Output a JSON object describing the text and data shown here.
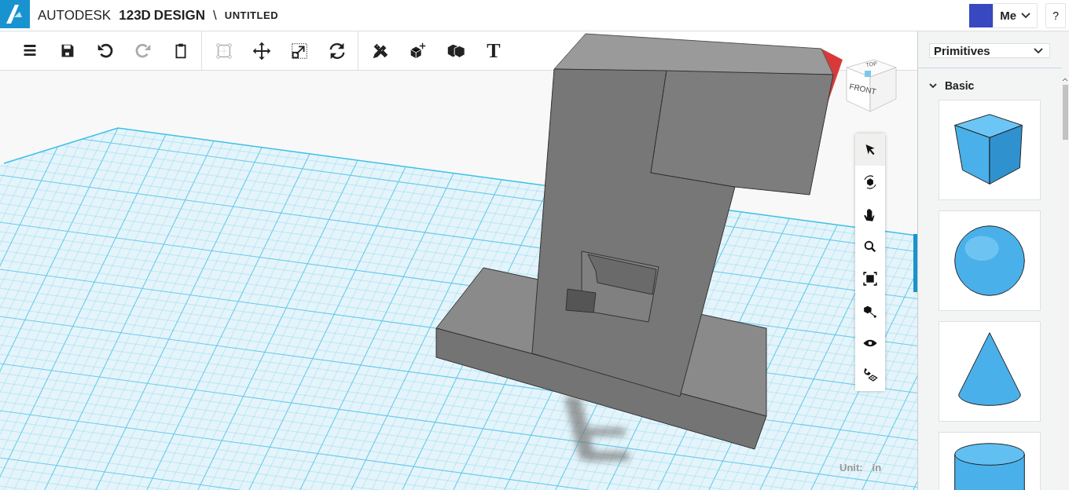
{
  "header": {
    "brand": "AUTODESK",
    "product": "123D",
    "product_tail": "DESIGN",
    "separator": "\\",
    "document": "UNTITLED",
    "user": "Me",
    "help": "?"
  },
  "toolbar": {
    "groups": [
      [
        {
          "kind": "menu",
          "disabled": false
        },
        {
          "kind": "save",
          "disabled": false
        },
        {
          "kind": "undo",
          "disabled": false
        },
        {
          "kind": "redo",
          "disabled": true
        },
        {
          "kind": "clipboard",
          "disabled": false
        }
      ],
      [
        {
          "kind": "frame",
          "disabled": true
        },
        {
          "kind": "move",
          "disabled": false
        },
        {
          "kind": "scale",
          "disabled": false
        },
        {
          "kind": "rotate",
          "disabled": false
        }
      ],
      [
        {
          "kind": "tools",
          "disabled": false
        },
        {
          "kind": "cube-move",
          "disabled": false
        },
        {
          "kind": "cubes",
          "disabled": false
        },
        {
          "kind": "text",
          "label": "T",
          "disabled": false
        }
      ]
    ]
  },
  "viewcube": {
    "top": "TOP",
    "front": "FRONT"
  },
  "nav_tools": [
    {
      "kind": "select",
      "selected": true
    },
    {
      "kind": "orbit",
      "selected": false
    },
    {
      "kind": "pan",
      "selected": false
    },
    {
      "kind": "zoom",
      "selected": false
    },
    {
      "kind": "fit",
      "selected": false
    },
    {
      "kind": "zoom-selected",
      "selected": false
    },
    {
      "kind": "visibility",
      "selected": false
    },
    {
      "kind": "snap",
      "selected": false
    }
  ],
  "unit": {
    "label": "Unit:",
    "value": "in"
  },
  "panel": {
    "dropdown": "Primitives",
    "section": {
      "title": "Basic",
      "expanded": true
    },
    "shapes": [
      {
        "kind": "box"
      },
      {
        "kind": "sphere"
      },
      {
        "kind": "cone"
      },
      {
        "kind": "cylinder"
      }
    ]
  }
}
